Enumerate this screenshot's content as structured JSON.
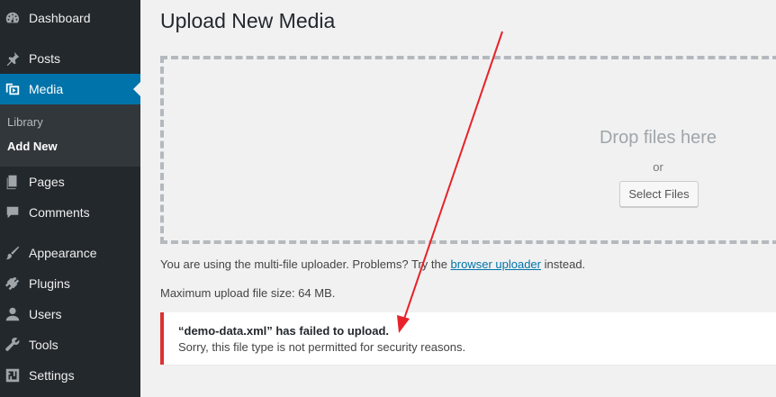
{
  "sidebar": {
    "items": [
      {
        "label": "Dashboard",
        "icon": "dashboard-icon"
      },
      {
        "label": "Posts",
        "icon": "pin-icon"
      },
      {
        "label": "Media",
        "icon": "media-icon"
      },
      {
        "label": "Pages",
        "icon": "pages-icon"
      },
      {
        "label": "Comments",
        "icon": "comment-icon"
      },
      {
        "label": "Appearance",
        "icon": "brush-icon"
      },
      {
        "label": "Plugins",
        "icon": "plugin-icon"
      },
      {
        "label": "Users",
        "icon": "user-icon"
      },
      {
        "label": "Tools",
        "icon": "wrench-icon"
      },
      {
        "label": "Settings",
        "icon": "settings-icon"
      }
    ],
    "submenu": {
      "library": "Library",
      "add_new": "Add New"
    },
    "active_color": "#0073aa"
  },
  "main": {
    "title": "Upload New Media",
    "dropzone": {
      "drop_text": "Drop files here",
      "or_text": "or",
      "select_button": "Select Files"
    },
    "uploader_note": {
      "prefix": "You are using the multi-file uploader. Problems? Try the",
      "link": "browser uploader",
      "suffix": "instead."
    },
    "max_size": "Maximum upload file size: 64 MB.",
    "error": {
      "title": "“demo-data.xml” has failed to upload.",
      "message": "Sorry, this file type is not permitted for security reasons.",
      "color": "#dc3232"
    }
  },
  "annotation": {
    "arrow_color": "#e8222a"
  }
}
